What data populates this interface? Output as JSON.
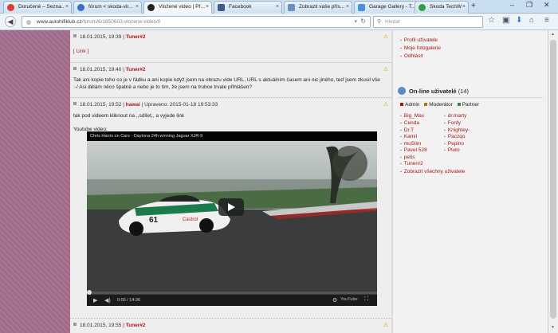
{
  "tabs": [
    {
      "label": "Doručené – Sezna...",
      "icon": "seznam-icon",
      "color": "#e03a2a"
    },
    {
      "label": "fórum < skoda-vir...",
      "icon": "forum-icon",
      "color": "#3a6fc7"
    },
    {
      "label": "Vložené video | Př...",
      "icon": "skoda-icon",
      "color": "#222222"
    },
    {
      "label": "Facebook",
      "icon": "facebook-icon",
      "color": "#3b5998"
    },
    {
      "label": "Zobrazit vaše přís...",
      "icon": "page-icon",
      "color": "#6a8fc0"
    },
    {
      "label": "Garage Gallery - T...",
      "icon": "garage-icon",
      "color": "#4a90e2"
    },
    {
      "label": "Škoda TechWeb -...",
      "icon": "techweb-icon",
      "color": "#2e9e3e"
    }
  ],
  "url": {
    "host": "www.autohifiklub.cz",
    "path": "/forum/6/1850603-vlozene-video/0"
  },
  "search_placeholder": "Hledat",
  "posts": [
    {
      "date": "18.01.2015, 19:39",
      "author": "Tuner#2",
      "body": "[ Link ]"
    },
    {
      "date": "18.01.2015, 19:40",
      "author": "Tuner#2",
      "body": "Tak ani kopie toho co je v řádku a ani kopie když jsem na obrazu vide URL, URL s aktuálním časem ani nic jiného, teď jsem zkusil vše :-/ Asi dělám něco špatně a nebo je to tím, že jsem na trubce trvale přihlášen?"
    },
    {
      "date": "18.01.2015, 19:52",
      "author": "hawai",
      "edited": "| Upraveno: 2015-01-18 19:53:33",
      "body": "tak pod videem kliknout na ,,sdílet,, a vyjede link",
      "extra": "Youtube video:"
    },
    {
      "date": "18.01.2015, 19:55",
      "author": "Tuner#2"
    }
  ],
  "video": {
    "title": "Chris Harris on Cars - Daytona 24h winning Jaguar XJR-9",
    "time": "0:00 / 14:36",
    "logo": "YouTube"
  },
  "sidebar": {
    "links": [
      "Profil uživatele",
      "Moje fotogalerie",
      "Odhlásit"
    ],
    "online_title": "On-line uživatelé",
    "online_count": "(14)",
    "legend": [
      {
        "label": "Admin",
        "color": "#b01616"
      },
      {
        "label": "Moderátor",
        "color": "#b07a10"
      },
      {
        "label": "Partner",
        "color": "#3a8a3a"
      }
    ],
    "users_left": [
      "Big_Max",
      "Cenda",
      "Dr.T",
      "Kamil",
      "muSlim",
      "Pavel 528",
      "petis",
      "Tuner#2"
    ],
    "users_right": [
      "dr.marty",
      "Fonfy",
      "Knightey-",
      "Paczqo",
      "Pepino",
      "Pluto"
    ],
    "show_all": "Zobrazit všechny uživatele"
  }
}
